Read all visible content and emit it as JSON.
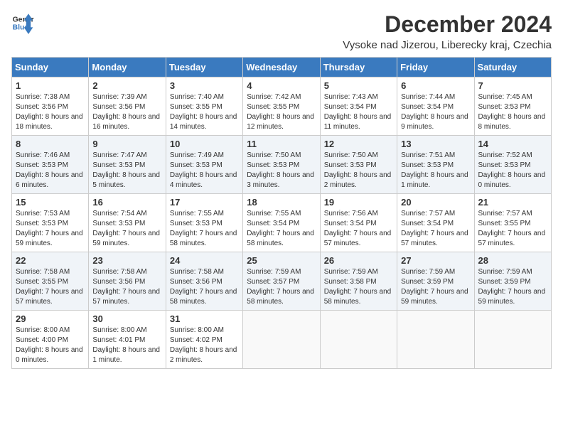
{
  "logo": {
    "line1": "General",
    "line2": "Blue"
  },
  "title": "December 2024",
  "subtitle": "Vysoke nad Jizerou, Liberecky kraj, Czechia",
  "weekdays": [
    "Sunday",
    "Monday",
    "Tuesday",
    "Wednesday",
    "Thursday",
    "Friday",
    "Saturday"
  ],
  "weeks": [
    [
      {
        "day": "1",
        "sunrise": "7:38 AM",
        "sunset": "3:56 PM",
        "daylight": "8 hours and 18 minutes."
      },
      {
        "day": "2",
        "sunrise": "7:39 AM",
        "sunset": "3:56 PM",
        "daylight": "8 hours and 16 minutes."
      },
      {
        "day": "3",
        "sunrise": "7:40 AM",
        "sunset": "3:55 PM",
        "daylight": "8 hours and 14 minutes."
      },
      {
        "day": "4",
        "sunrise": "7:42 AM",
        "sunset": "3:55 PM",
        "daylight": "8 hours and 12 minutes."
      },
      {
        "day": "5",
        "sunrise": "7:43 AM",
        "sunset": "3:54 PM",
        "daylight": "8 hours and 11 minutes."
      },
      {
        "day": "6",
        "sunrise": "7:44 AM",
        "sunset": "3:54 PM",
        "daylight": "8 hours and 9 minutes."
      },
      {
        "day": "7",
        "sunrise": "7:45 AM",
        "sunset": "3:53 PM",
        "daylight": "8 hours and 8 minutes."
      }
    ],
    [
      {
        "day": "8",
        "sunrise": "7:46 AM",
        "sunset": "3:53 PM",
        "daylight": "8 hours and 6 minutes."
      },
      {
        "day": "9",
        "sunrise": "7:47 AM",
        "sunset": "3:53 PM",
        "daylight": "8 hours and 5 minutes."
      },
      {
        "day": "10",
        "sunrise": "7:49 AM",
        "sunset": "3:53 PM",
        "daylight": "8 hours and 4 minutes."
      },
      {
        "day": "11",
        "sunrise": "7:50 AM",
        "sunset": "3:53 PM",
        "daylight": "8 hours and 3 minutes."
      },
      {
        "day": "12",
        "sunrise": "7:50 AM",
        "sunset": "3:53 PM",
        "daylight": "8 hours and 2 minutes."
      },
      {
        "day": "13",
        "sunrise": "7:51 AM",
        "sunset": "3:53 PM",
        "daylight": "8 hours and 1 minute."
      },
      {
        "day": "14",
        "sunrise": "7:52 AM",
        "sunset": "3:53 PM",
        "daylight": "8 hours and 0 minutes."
      }
    ],
    [
      {
        "day": "15",
        "sunrise": "7:53 AM",
        "sunset": "3:53 PM",
        "daylight": "7 hours and 59 minutes."
      },
      {
        "day": "16",
        "sunrise": "7:54 AM",
        "sunset": "3:53 PM",
        "daylight": "7 hours and 59 minutes."
      },
      {
        "day": "17",
        "sunrise": "7:55 AM",
        "sunset": "3:53 PM",
        "daylight": "7 hours and 58 minutes."
      },
      {
        "day": "18",
        "sunrise": "7:55 AM",
        "sunset": "3:54 PM",
        "daylight": "7 hours and 58 minutes."
      },
      {
        "day": "19",
        "sunrise": "7:56 AM",
        "sunset": "3:54 PM",
        "daylight": "7 hours and 57 minutes."
      },
      {
        "day": "20",
        "sunrise": "7:57 AM",
        "sunset": "3:54 PM",
        "daylight": "7 hours and 57 minutes."
      },
      {
        "day": "21",
        "sunrise": "7:57 AM",
        "sunset": "3:55 PM",
        "daylight": "7 hours and 57 minutes."
      }
    ],
    [
      {
        "day": "22",
        "sunrise": "7:58 AM",
        "sunset": "3:55 PM",
        "daylight": "7 hours and 57 minutes."
      },
      {
        "day": "23",
        "sunrise": "7:58 AM",
        "sunset": "3:56 PM",
        "daylight": "7 hours and 57 minutes."
      },
      {
        "day": "24",
        "sunrise": "7:58 AM",
        "sunset": "3:56 PM",
        "daylight": "7 hours and 58 minutes."
      },
      {
        "day": "25",
        "sunrise": "7:59 AM",
        "sunset": "3:57 PM",
        "daylight": "7 hours and 58 minutes."
      },
      {
        "day": "26",
        "sunrise": "7:59 AM",
        "sunset": "3:58 PM",
        "daylight": "7 hours and 58 minutes."
      },
      {
        "day": "27",
        "sunrise": "7:59 AM",
        "sunset": "3:59 PM",
        "daylight": "7 hours and 59 minutes."
      },
      {
        "day": "28",
        "sunrise": "7:59 AM",
        "sunset": "3:59 PM",
        "daylight": "7 hours and 59 minutes."
      }
    ],
    [
      {
        "day": "29",
        "sunrise": "8:00 AM",
        "sunset": "4:00 PM",
        "daylight": "8 hours and 0 minutes."
      },
      {
        "day": "30",
        "sunrise": "8:00 AM",
        "sunset": "4:01 PM",
        "daylight": "8 hours and 1 minute."
      },
      {
        "day": "31",
        "sunrise": "8:00 AM",
        "sunset": "4:02 PM",
        "daylight": "8 hours and 2 minutes."
      },
      null,
      null,
      null,
      null
    ]
  ]
}
